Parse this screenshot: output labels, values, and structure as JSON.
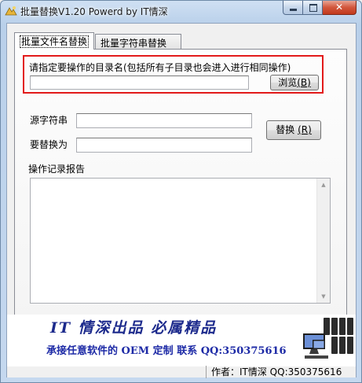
{
  "window": {
    "title": "批量替换V1.20  Powerd by IT情深"
  },
  "tabs": [
    {
      "label": "批量文件名替换"
    },
    {
      "label": "批量字符串替换"
    }
  ],
  "directory": {
    "prompt": "请指定要操作的目录名(包括所有子目录也会进入进行相同操作)",
    "value": "",
    "browse_label": "浏览",
    "browse_hotkey": "(B)"
  },
  "replace": {
    "source_label": "源字符串",
    "source_value": "",
    "target_label": "要替换为",
    "target_value": "",
    "button_label": "替换",
    "button_hotkey": "(R)"
  },
  "log": {
    "label": "操作记录报告",
    "content": ""
  },
  "banner": {
    "line1": "IT 情深出品   必属精品",
    "line2": "承接任意软件的 OEM 定制  联系 QQ:350375616"
  },
  "status": {
    "author": "作者：IT情深  QQ:350375616"
  },
  "colors": {
    "highlight_frame": "#e21a1a",
    "banner_text": "#1c2a8c"
  }
}
